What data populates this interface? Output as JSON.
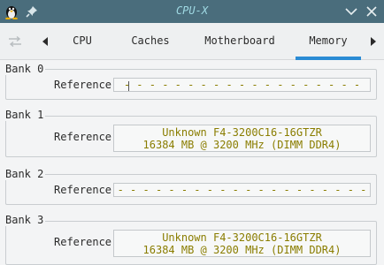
{
  "window": {
    "title": "CPU-X",
    "app_icon": "tux-penguin-icon",
    "pin_icon": "pin-icon",
    "minimize_icon": "chevron-down-icon",
    "close_icon": "close-icon"
  },
  "tabs": {
    "items": [
      {
        "label": "CPU"
      },
      {
        "label": "Caches"
      },
      {
        "label": "Motherboard"
      },
      {
        "label": "Memory"
      }
    ],
    "active": "Memory"
  },
  "banks": [
    {
      "label": "Bank 0",
      "ref_label": "Reference",
      "line1": "- - - - - - - - - - - - - - - - - - -",
      "line2": ""
    },
    {
      "label": "Bank 1",
      "ref_label": "Reference",
      "line1": "Unknown F4-3200C16-16GTZR",
      "line2": "16384 MB @ 3200 MHz (DIMM DDR4)"
    },
    {
      "label": "Bank 2",
      "ref_label": "Reference",
      "line1": "- - - - - - - - - - - - - - - - - - - -",
      "line2": ""
    },
    {
      "label": "Bank 3",
      "ref_label": "Reference",
      "line1": "Unknown F4-3200C16-16GTZR",
      "line2": "16384 MB @ 3200 MHz (DIMM DDR4)"
    }
  ],
  "colors": {
    "titlebar": "#4a6d7c",
    "title_text": "#9fd9e3",
    "accent": "#2a8bd4",
    "value_text": "#8a7d00"
  }
}
